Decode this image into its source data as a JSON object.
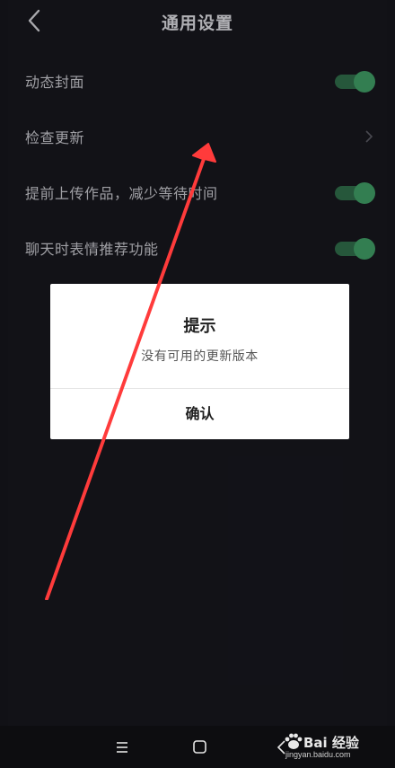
{
  "header": {
    "title": "通用设置"
  },
  "settings": [
    {
      "label": "动态封面",
      "control": "toggle",
      "on": true
    },
    {
      "label": "检查更新",
      "control": "chevron"
    },
    {
      "label": "提前上传作品，减少等待时间",
      "control": "toggle",
      "on": true
    },
    {
      "label": "聊天时表情推荐功能",
      "control": "toggle",
      "on": true
    }
  ],
  "dialog": {
    "title": "提示",
    "message": "没有可用的更新版本",
    "confirm_label": "确认"
  },
  "watermark": {
    "brand": "Bai 经验",
    "url": "jingyan.baidu.com"
  },
  "colors": {
    "toggle_on": "#3f9a63",
    "background": "#16161d",
    "arrow": "#ff3b3b"
  },
  "icons": {
    "back": "chevron-left-icon",
    "menu": "menu-icon",
    "home": "home-icon",
    "nav_back": "nav-back-icon"
  }
}
